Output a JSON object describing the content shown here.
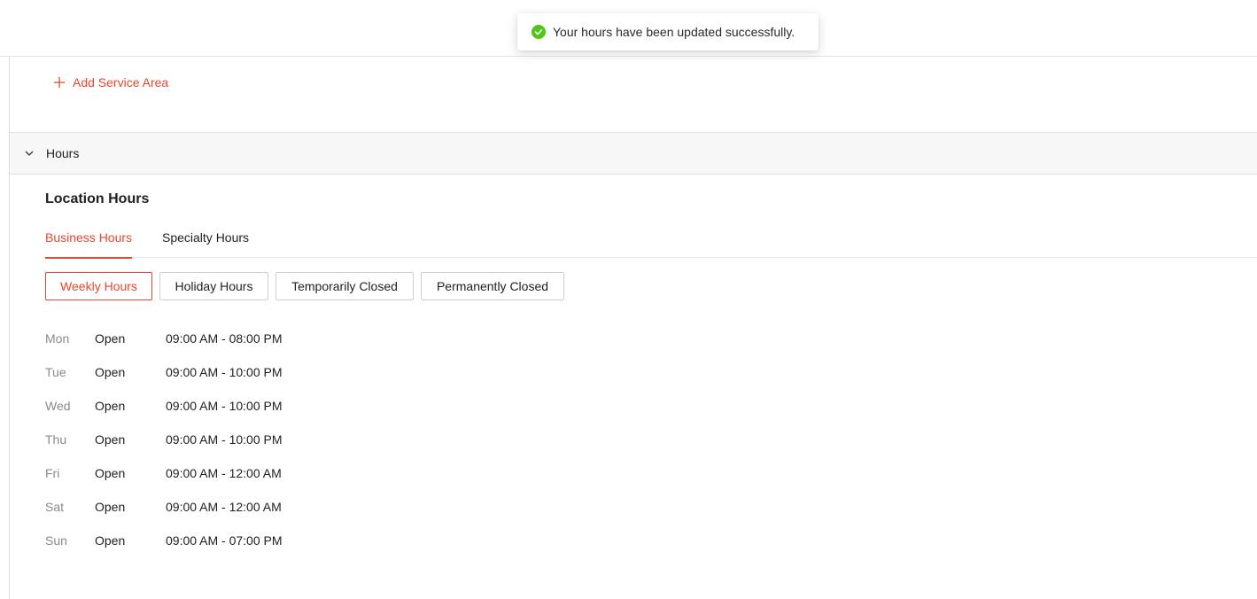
{
  "toast": {
    "message": "Your hours have been updated successfully.",
    "icon": "check-circle-icon",
    "color": "#52c41a"
  },
  "service_area": {
    "add_label": "Add Service Area",
    "icon": "plus-icon"
  },
  "section": {
    "title": "Hours",
    "icon": "chevron-down-icon"
  },
  "location_hours": {
    "title": "Location Hours",
    "tabs": [
      {
        "label": "Business Hours",
        "active": true
      },
      {
        "label": "Specialty Hours",
        "active": false
      }
    ],
    "filters": [
      {
        "label": "Weekly Hours",
        "active": true
      },
      {
        "label": "Holiday Hours",
        "active": false
      },
      {
        "label": "Temporarily Closed",
        "active": false
      },
      {
        "label": "Permanently Closed",
        "active": false
      }
    ],
    "schedule": [
      {
        "day": "Mon",
        "status": "Open",
        "hours": "09:00 AM - 08:00 PM"
      },
      {
        "day": "Tue",
        "status": "Open",
        "hours": "09:00 AM - 10:00 PM"
      },
      {
        "day": "Wed",
        "status": "Open",
        "hours": "09:00 AM - 10:00 PM"
      },
      {
        "day": "Thu",
        "status": "Open",
        "hours": "09:00 AM - 10:00 PM"
      },
      {
        "day": "Fri",
        "status": "Open",
        "hours": "09:00 AM - 12:00 AM"
      },
      {
        "day": "Sat",
        "status": "Open",
        "hours": "09:00 AM - 12:00 AM"
      },
      {
        "day": "Sun",
        "status": "Open",
        "hours": "09:00 AM - 07:00 PM"
      }
    ]
  },
  "colors": {
    "accent": "#e8472f",
    "success": "#52c41a",
    "muted_text": "#8a8a8a"
  }
}
